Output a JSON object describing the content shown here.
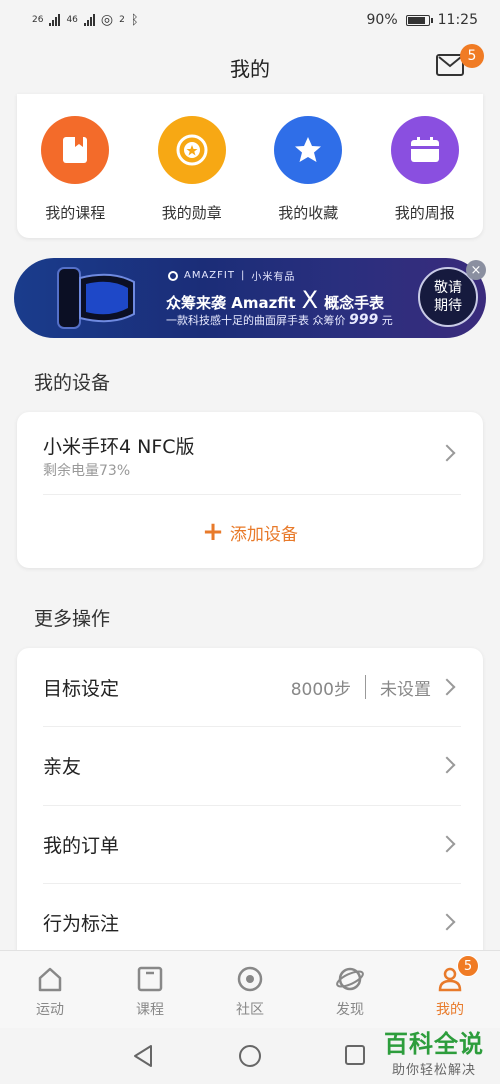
{
  "status_bar": {
    "battery": "90%",
    "time": "11:25",
    "net1": "26",
    "net2": "46",
    "wifi_num": "2"
  },
  "header": {
    "title": "我的",
    "mail_badge": "5"
  },
  "quick": [
    {
      "label": "我的课程",
      "color": "#f36b2a",
      "icon": "book-icon"
    },
    {
      "label": "我的勋章",
      "color": "#f7a814",
      "icon": "medal-icon"
    },
    {
      "label": "我的收藏",
      "color": "#2f6ee8",
      "icon": "star-icon"
    },
    {
      "label": "我的周报",
      "color": "#8a4fe0",
      "icon": "report-icon"
    }
  ],
  "banner": {
    "brand": "AMAZFIT",
    "partner": "小米有品",
    "headline_pre": "众筹来袭 Amazfit",
    "headline_x": "X",
    "headline_post": "概念手表",
    "sub_pre": "一款科技感十足的曲面屏手表 众筹价",
    "price": "999",
    "sub_post": "元",
    "cta_line1": "敬请",
    "cta_line2": "期待",
    "close": "×"
  },
  "devices": {
    "section_title": "我的设备",
    "name": "小米手环4 NFC版",
    "battery": "剩余电量73%",
    "add_label": "添加设备"
  },
  "more": {
    "section_title": "更多操作",
    "rows": [
      {
        "label": "目标设定",
        "steps": "8000步",
        "status": "未设置"
      },
      {
        "label": "亲友"
      },
      {
        "label": "我的订单"
      },
      {
        "label": "行为标注"
      }
    ]
  },
  "tabs": [
    {
      "label": "运动",
      "icon": "home-icon"
    },
    {
      "label": "课程",
      "icon": "course-icon"
    },
    {
      "label": "社区",
      "icon": "community-icon"
    },
    {
      "label": "发现",
      "icon": "discover-icon"
    },
    {
      "label": "我的",
      "icon": "profile-icon",
      "badge": "5"
    }
  ],
  "watermark": {
    "title": "百科全说",
    "subtitle": "助你轻松解决"
  },
  "colors": {
    "accent": "#e87a2a"
  }
}
